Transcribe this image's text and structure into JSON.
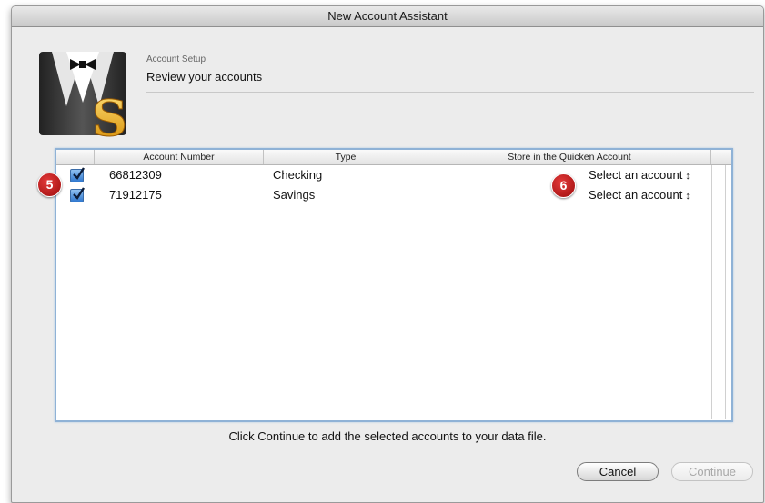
{
  "window": {
    "title": "New Account Assistant"
  },
  "header": {
    "section_label": "Account Setup",
    "section_title": "Review your accounts"
  },
  "table": {
    "columns": [
      "Account Number",
      "Type",
      "Store in the Quicken Account"
    ],
    "rows": [
      {
        "account_number": "66812309",
        "type": "Checking",
        "store_in": "Select an account",
        "checked": true
      },
      {
        "account_number": "71912175",
        "type": "Savings",
        "store_in": "Select an account",
        "checked": true
      }
    ]
  },
  "callouts": [
    "5",
    "6"
  ],
  "footer": {
    "message": "Click Continue to add the selected accounts to your data file."
  },
  "buttons": {
    "cancel": "Cancel",
    "continue": "Continue"
  },
  "colors": {
    "checkbox_blue": "#2f78cf",
    "callout_red": "#c21a1a",
    "focus_ring": "#8fb2d6"
  },
  "icons": {
    "logo": "tuxedo-dollar-icon",
    "checkbox": "checkmark-icon",
    "popup": "up-down-arrows-icon"
  }
}
